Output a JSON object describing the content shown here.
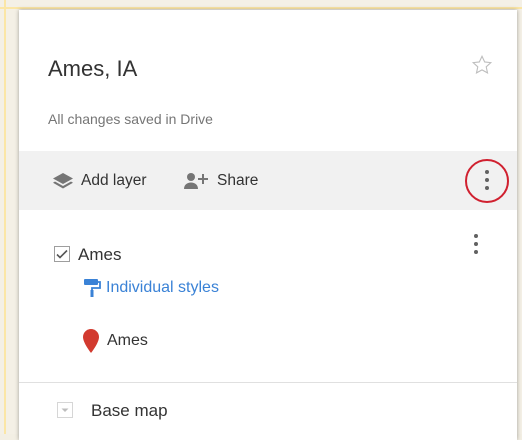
{
  "panel": {
    "title": "Ames, IA",
    "subtitle": "All changes saved in Drive"
  },
  "toolbar": {
    "add_layer_label": "Add layer",
    "share_label": "Share"
  },
  "layer": {
    "name": "Ames",
    "checked": true,
    "style_label": "Individual styles",
    "feature_label": "Ames",
    "marker_color": "#d23a2f"
  },
  "base_map": {
    "label": "Base map"
  },
  "colors": {
    "accent_blue": "#3a82d6",
    "highlight_circle": "#d0202f"
  },
  "icons": [
    "star-icon",
    "layers-icon",
    "add-person-icon",
    "more-vert-icon",
    "checkbox-icon",
    "paint-roller-icon",
    "map-marker-icon",
    "chevron-down-icon"
  ]
}
